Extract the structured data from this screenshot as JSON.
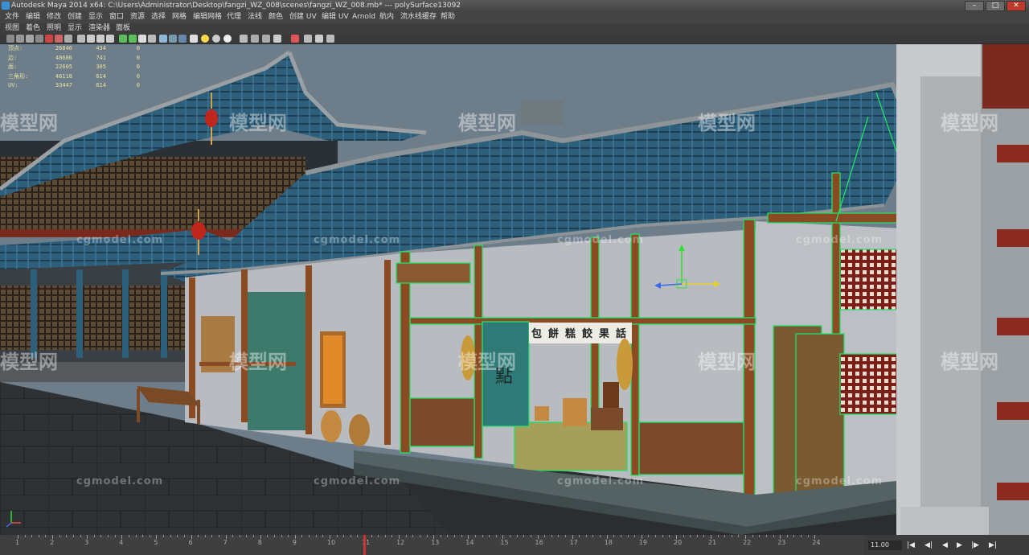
{
  "window": {
    "title": "Autodesk Maya 2014 x64: C:\\Users\\Administrator\\Desktop\\fangzi_WZ_008\\scenes\\fangzi_WZ_008.mb* --- polySurface13092",
    "minimize": "–",
    "maximize": "□",
    "close": "✕"
  },
  "menu": [
    "文件",
    "编辑",
    "修改",
    "创建",
    "显示",
    "窗口",
    "资源",
    "选择",
    "网格",
    "编辑网格",
    "代理",
    "法线",
    "颜色",
    "创建 UV",
    "编辑 UV",
    "Arnold",
    "航内",
    "流水线缓存",
    "帮助"
  ],
  "panel_menu": [
    "视图",
    "着色",
    "照明",
    "显示",
    "渲染器",
    "面板"
  ],
  "hud": {
    "rows": [
      {
        "label": "顶点:",
        "a": "26846",
        "b": "434",
        "c": "0"
      },
      {
        "label": "边:",
        "a": "48686",
        "b": "741",
        "c": "0"
      },
      {
        "label": "面:",
        "a": "22605",
        "b": "305",
        "c": "0"
      },
      {
        "label": "三角形:",
        "a": "46118",
        "b": "614",
        "c": "0"
      },
      {
        "label": "UV:",
        "a": "33447",
        "b": "614",
        "c": "0"
      }
    ]
  },
  "watermarks": {
    "site": "cgmodel.com",
    "logo": "模型网"
  },
  "signs": {
    "shop_chars": [
      "包",
      "餅",
      "糕",
      "餃",
      "果",
      "話"
    ],
    "banner": "點"
  },
  "timeline": {
    "ticks": [
      "1",
      "2",
      "3",
      "4",
      "5",
      "6",
      "7",
      "8",
      "9",
      "10",
      "11",
      "12",
      "13",
      "14",
      "15",
      "16",
      "17",
      "18",
      "19",
      "20",
      "21",
      "22",
      "23",
      "24"
    ],
    "current_frame": "11.00"
  },
  "playback": [
    "|◀",
    "◀|",
    "◀",
    "▶",
    "|▶",
    "▶|"
  ],
  "colors": {
    "sky": "#6e7d8a",
    "roof_tile": "#2e5f7a",
    "wood": "#8a4a22",
    "wall": "#b8bcc0",
    "wireframe": "#22e06a",
    "ground": "#2f3234"
  }
}
